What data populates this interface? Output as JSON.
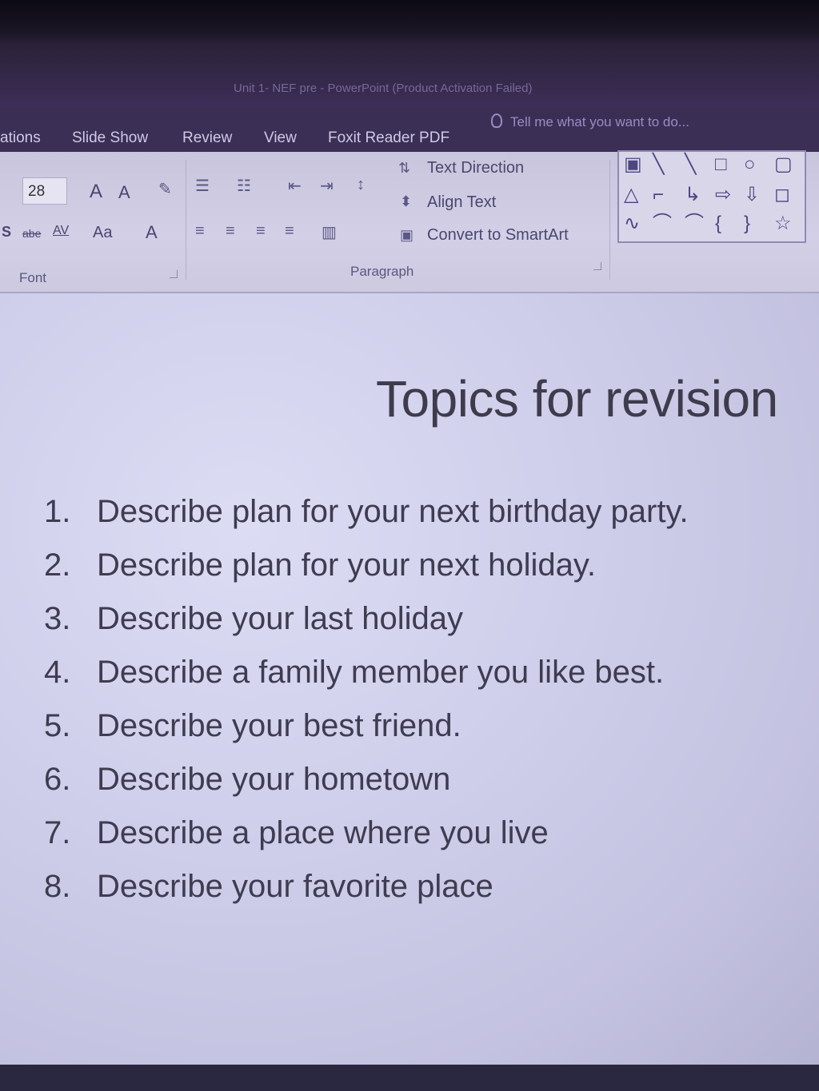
{
  "window_title": "Unit 1- NEF pre - PowerPoint (Product Activation Failed)",
  "tabs": [
    "ations",
    "Slide Show",
    "Review",
    "View",
    "Foxit Reader PDF"
  ],
  "tell_me": "Tell me what you want to do...",
  "ribbon": {
    "font_size": "28",
    "grow_font": "A",
    "shrink_font": "A",
    "shadow_label": "S",
    "strike_label": "abe",
    "spacing_label": "AV",
    "case_label": "Aa",
    "font_color_label": "A",
    "text_direction": "Text Direction",
    "align_text": "Align Text",
    "convert_smartart": "Convert to SmartArt",
    "group_font": "Font",
    "group_paragraph": "Paragraph"
  },
  "slide": {
    "title": "Topics for revision",
    "items": [
      {
        "num": "1.",
        "text": "Describe plan for your next birthday party."
      },
      {
        "num": "2.",
        "text": "Describe plan for your next holiday."
      },
      {
        "num": "3.",
        "text": "Describe your last holiday"
      },
      {
        "num": "4.",
        "text": "Describe a family member you like best."
      },
      {
        "num": "5.",
        "text": "Describe your best friend."
      },
      {
        "num": "6.",
        "text": "Describe your hometown"
      },
      {
        "num": "7.",
        "text": "Describe a place where you live"
      },
      {
        "num": "8.",
        "text": "Describe your favorite place"
      }
    ]
  }
}
